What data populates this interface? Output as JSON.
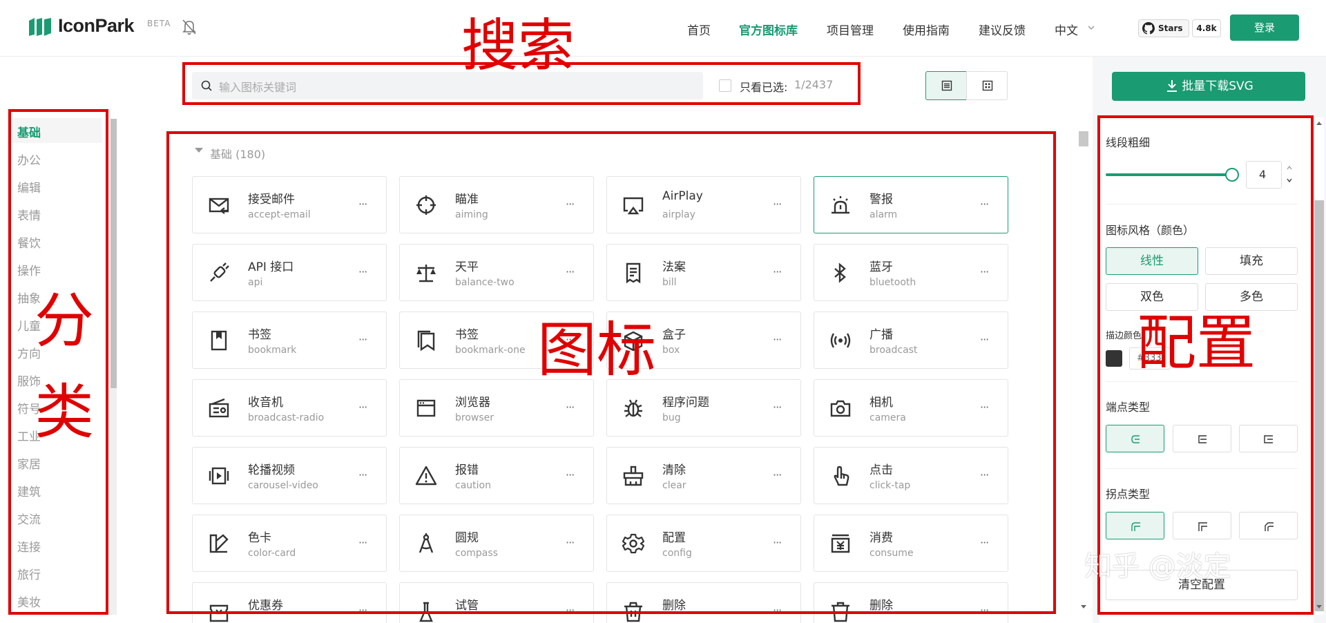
{
  "header": {
    "logo_text": "IconPark",
    "logo_badge": "BETA",
    "nav": [
      "首页",
      "官方图标库",
      "项目管理",
      "使用指南",
      "建议反馈",
      "中文"
    ],
    "github_label": "Stars",
    "github_count": "4.8k",
    "login_label": "登录",
    "accent_color": "#1a9b72"
  },
  "search": {
    "placeholder": "输入图标关键词",
    "only_selected_label": "只看已选:",
    "selected_count": "1/2437"
  },
  "sidebar": {
    "categories": [
      "基础",
      "办公",
      "编辑",
      "表情",
      "餐饮",
      "操作",
      "抽象",
      "儿童",
      "方向",
      "服饰",
      "符号",
      "工业",
      "家居",
      "建筑",
      "交流",
      "连接",
      "旅行",
      "美妆"
    ],
    "active_index": 0
  },
  "group": {
    "title": "基础 (180)"
  },
  "icons": [
    {
      "cn": "接受邮件",
      "en": "accept-email",
      "icon": "mail-receive-icon"
    },
    {
      "cn": "瞄准",
      "en": "aiming",
      "icon": "crosshair-icon"
    },
    {
      "cn": "AirPlay",
      "en": "airplay",
      "icon": "airplay-icon"
    },
    {
      "cn": "警报",
      "en": "alarm",
      "icon": "alarm-light-icon",
      "selected": true
    },
    {
      "cn": "API 接口",
      "en": "api",
      "icon": "api-plug-icon"
    },
    {
      "cn": "天平",
      "en": "balance-two",
      "icon": "balance-scale-icon"
    },
    {
      "cn": "法案",
      "en": "bill",
      "icon": "bill-icon"
    },
    {
      "cn": "蓝牙",
      "en": "bluetooth",
      "icon": "bluetooth-icon"
    },
    {
      "cn": "书签",
      "en": "bookmark",
      "icon": "bookmark-icon"
    },
    {
      "cn": "书签",
      "en": "bookmark-one",
      "icon": "bookmark-one-icon"
    },
    {
      "cn": "盒子",
      "en": "box",
      "icon": "box-icon"
    },
    {
      "cn": "广播",
      "en": "broadcast",
      "icon": "broadcast-icon"
    },
    {
      "cn": "收音机",
      "en": "broadcast-radio",
      "icon": "radio-icon"
    },
    {
      "cn": "浏览器",
      "en": "browser",
      "icon": "browser-icon"
    },
    {
      "cn": "程序问题",
      "en": "bug",
      "icon": "bug-icon"
    },
    {
      "cn": "相机",
      "en": "camera",
      "icon": "camera-icon"
    },
    {
      "cn": "轮播视频",
      "en": "carousel-video",
      "icon": "carousel-video-icon"
    },
    {
      "cn": "报错",
      "en": "caution",
      "icon": "caution-icon"
    },
    {
      "cn": "清除",
      "en": "clear",
      "icon": "clear-broom-icon"
    },
    {
      "cn": "点击",
      "en": "click-tap",
      "icon": "click-tap-icon"
    },
    {
      "cn": "色卡",
      "en": "color-card",
      "icon": "color-card-icon"
    },
    {
      "cn": "圆规",
      "en": "compass",
      "icon": "compass-icon"
    },
    {
      "cn": "配置",
      "en": "config",
      "icon": "config-gear-icon"
    },
    {
      "cn": "消费",
      "en": "consume",
      "icon": "consume-icon"
    },
    {
      "cn": "优惠券",
      "en": "",
      "icon": "coupon-icon"
    },
    {
      "cn": "试管",
      "en": "",
      "icon": "test-tube-icon"
    },
    {
      "cn": "删除",
      "en": "",
      "icon": "delete-icon"
    },
    {
      "cn": "删除",
      "en": "",
      "icon": "delete-two-icon"
    }
  ],
  "card_more": "···",
  "panel": {
    "download_label": "批量下载SVG",
    "stroke_width_label": "线段粗细",
    "stroke_width_value": "4",
    "stroke_width_level": 1.0,
    "style_label": "图标风格（颜色）",
    "styles": [
      "线性",
      "填充",
      "双色",
      "多色"
    ],
    "active_style_index": 0,
    "stroke_color_label": "描边颜色",
    "stroke_color_value": "#333",
    "line_cap_label": "端点类型",
    "line_join_label": "拐点类型",
    "reset_label": "清空配置"
  },
  "annotations": {
    "search": "搜索",
    "category_a": "分",
    "category_b": "类",
    "icons": "图标",
    "config": "配置",
    "color": "#e00000"
  },
  "watermark": "知乎 @淡定"
}
